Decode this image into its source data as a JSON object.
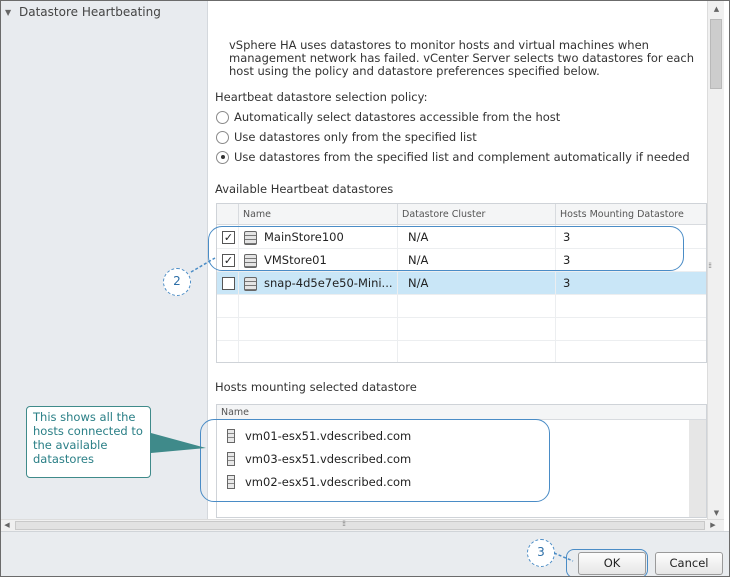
{
  "nav": {
    "section_label": "Datastore Heartbeating"
  },
  "content": {
    "description": "vSphere HA uses datastores to monitor hosts and virtual machines when management network has failed. vCenter Server selects two datastores for each host using the policy and datastore preferences specified below.",
    "policy_label": "Heartbeat datastore selection policy:",
    "policies": [
      {
        "label": "Automatically select datastores accessible from the host",
        "selected": false
      },
      {
        "label": "Use datastores only from the specified list",
        "selected": false
      },
      {
        "label": "Use datastores from the specified list and complement automatically if needed",
        "selected": true
      }
    ],
    "available_label": "Available Heartbeat datastores",
    "datastore_columns": [
      "Name",
      "Datastore Cluster",
      "Hosts Mounting Datastore"
    ],
    "datastores": [
      {
        "checked": true,
        "name": "MainStore100",
        "cluster": "N/A",
        "hosts": "3",
        "selected": false
      },
      {
        "checked": true,
        "name": "VMStore01",
        "cluster": "N/A",
        "hosts": "3",
        "selected": false
      },
      {
        "checked": false,
        "name": "snap-4d5e7e50-Mini...",
        "cluster": "N/A",
        "hosts": "3",
        "selected": true
      }
    ],
    "hosts_label": "Hosts mounting selected datastore",
    "hosts_column": "Name",
    "hosts": [
      "vm01-esx51.vdescribed.com",
      "vm03-esx51.vdescribed.com",
      "vm02-esx51.vdescribed.com"
    ]
  },
  "footer": {
    "ok_label": "OK",
    "cancel_label": "Cancel"
  },
  "annotations": {
    "bubble_2": "2",
    "bubble_3": "3",
    "note": "This shows all the hosts connected to the available datastores"
  },
  "icons": {
    "nav_chevron": "chevron-down-icon",
    "datastore": "datastore-icon",
    "host": "host-icon"
  },
  "colors": {
    "selected_row": "#c9e6f7",
    "annotation_blue": "#4a8cc6",
    "annotation_teal": "#3f8a8a"
  }
}
